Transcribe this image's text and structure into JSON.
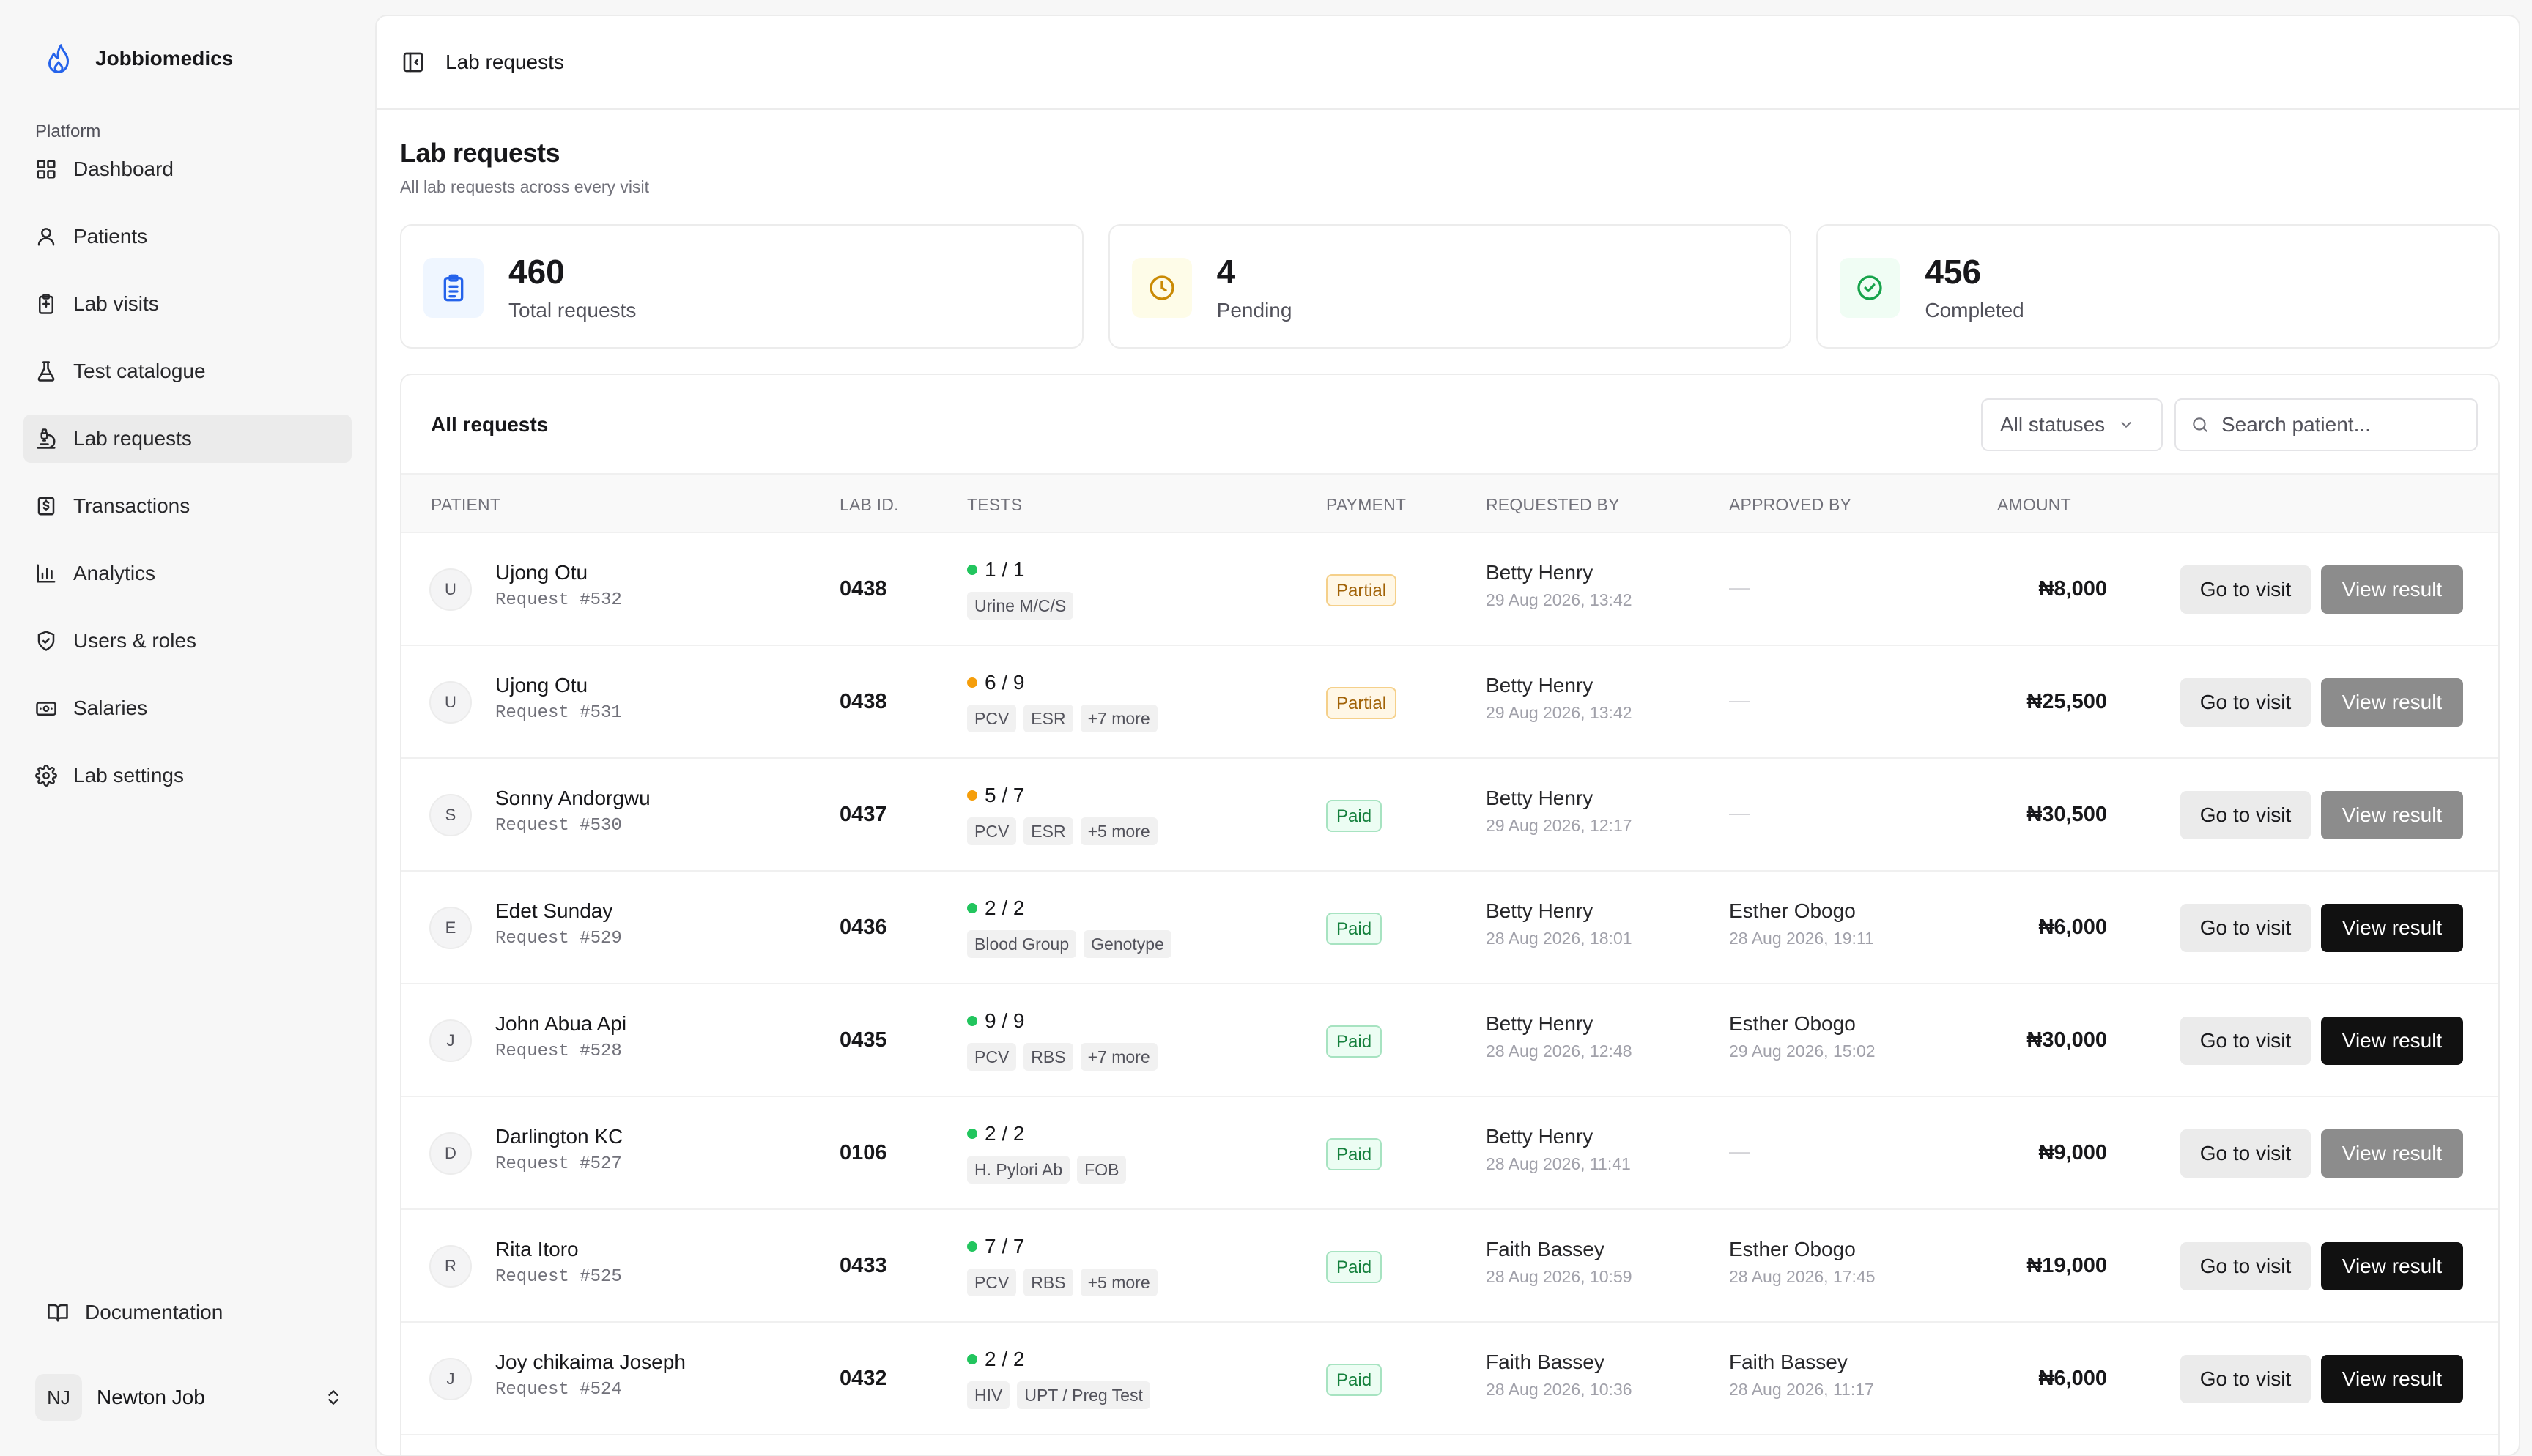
{
  "brand": {
    "name": "Jobbiomedics"
  },
  "sidebar": {
    "section": "Platform",
    "items": [
      {
        "label": "Dashboard",
        "icon": "dashboard-icon",
        "active": false
      },
      {
        "label": "Patients",
        "icon": "user-icon",
        "active": false
      },
      {
        "label": "Lab visits",
        "icon": "clipboard-icon",
        "active": false
      },
      {
        "label": "Test catalogue",
        "icon": "flask-icon",
        "active": false
      },
      {
        "label": "Lab requests",
        "icon": "microscope-icon",
        "active": true
      },
      {
        "label": "Transactions",
        "icon": "receipt-icon",
        "active": false
      },
      {
        "label": "Analytics",
        "icon": "bar-chart-icon",
        "active": false
      },
      {
        "label": "Users & roles",
        "icon": "shield-icon",
        "active": false
      },
      {
        "label": "Salaries",
        "icon": "wallet-icon",
        "active": false
      },
      {
        "label": "Lab settings",
        "icon": "gear-icon",
        "active": false
      }
    ],
    "documentation": "Documentation",
    "user": {
      "initials": "NJ",
      "name": "Newton Job"
    }
  },
  "topbar": {
    "breadcrumb": "Lab requests"
  },
  "page": {
    "title": "Lab requests",
    "subtitle": "All lab requests across every visit"
  },
  "stats": [
    {
      "value": "460",
      "label": "Total requests",
      "icon": "clipboard-list-icon",
      "color": "#2563eb",
      "bg": "#eff6ff"
    },
    {
      "value": "4",
      "label": "Pending",
      "icon": "clock-icon",
      "color": "#ca8a04",
      "bg": "#fefce8"
    },
    {
      "value": "456",
      "label": "Completed",
      "icon": "check-circle-icon",
      "color": "#16a34a",
      "bg": "#f0fdf4"
    }
  ],
  "table": {
    "title": "All requests",
    "status_filter": "All statuses",
    "search_placeholder": "Search patient...",
    "columns": [
      "Patient",
      "Lab ID.",
      "Tests",
      "Payment",
      "Requested by",
      "Approved by",
      "Amount"
    ],
    "go_label": "Go to visit",
    "view_label": "View result",
    "rows": [
      {
        "initial": "U",
        "name": "Ujong Otu",
        "request": "Request #532",
        "lab_id": "0438",
        "tests_done": "1 / 1",
        "status_dot": "#22c55e",
        "tags": [
          "Urine M/C/S"
        ],
        "payment": "Partial",
        "requested_by": "Betty Henry",
        "requested_at": "29 Aug 2026, 13:42",
        "approved_by": "",
        "approved_at": "",
        "amount": "₦8,000",
        "result_ready": false
      },
      {
        "initial": "U",
        "name": "Ujong Otu",
        "request": "Request #531",
        "lab_id": "0438",
        "tests_done": "6 / 9",
        "status_dot": "#f59e0b",
        "tags": [
          "PCV",
          "ESR",
          "+7 more"
        ],
        "payment": "Partial",
        "requested_by": "Betty Henry",
        "requested_at": "29 Aug 2026, 13:42",
        "approved_by": "",
        "approved_at": "",
        "amount": "₦25,500",
        "result_ready": false
      },
      {
        "initial": "S",
        "name": "Sonny Andorgwu",
        "request": "Request #530",
        "lab_id": "0437",
        "tests_done": "5 / 7",
        "status_dot": "#f59e0b",
        "tags": [
          "PCV",
          "ESR",
          "+5 more"
        ],
        "payment": "Paid",
        "requested_by": "Betty Henry",
        "requested_at": "29 Aug 2026, 12:17",
        "approved_by": "",
        "approved_at": "",
        "amount": "₦30,500",
        "result_ready": false
      },
      {
        "initial": "E",
        "name": "Edet Sunday",
        "request": "Request #529",
        "lab_id": "0436",
        "tests_done": "2 / 2",
        "status_dot": "#22c55e",
        "tags": [
          "Blood Group",
          "Genotype"
        ],
        "payment": "Paid",
        "requested_by": "Betty Henry",
        "requested_at": "28 Aug 2026, 18:01",
        "approved_by": "Esther Obogo",
        "approved_at": "28 Aug 2026, 19:11",
        "amount": "₦6,000",
        "result_ready": true
      },
      {
        "initial": "J",
        "name": "John Abua Api",
        "request": "Request #528",
        "lab_id": "0435",
        "tests_done": "9 / 9",
        "status_dot": "#22c55e",
        "tags": [
          "PCV",
          "RBS",
          "+7 more"
        ],
        "payment": "Paid",
        "requested_by": "Betty Henry",
        "requested_at": "28 Aug 2026, 12:48",
        "approved_by": "Esther Obogo",
        "approved_at": "29 Aug 2026, 15:02",
        "amount": "₦30,000",
        "result_ready": true
      },
      {
        "initial": "D",
        "name": "Darlington KC",
        "request": "Request #527",
        "lab_id": "0106",
        "tests_done": "2 / 2",
        "status_dot": "#22c55e",
        "tags": [
          "H. Pylori Ab",
          "FOB"
        ],
        "payment": "Paid",
        "requested_by": "Betty Henry",
        "requested_at": "28 Aug 2026, 11:41",
        "approved_by": "",
        "approved_at": "",
        "amount": "₦9,000",
        "result_ready": false
      },
      {
        "initial": "R",
        "name": "Rita Itoro",
        "request": "Request #525",
        "lab_id": "0433",
        "tests_done": "7 / 7",
        "status_dot": "#22c55e",
        "tags": [
          "PCV",
          "RBS",
          "+5 more"
        ],
        "payment": "Paid",
        "requested_by": "Faith Bassey",
        "requested_at": "28 Aug 2026, 10:59",
        "approved_by": "Esther Obogo",
        "approved_at": "28 Aug 2026, 17:45",
        "amount": "₦19,000",
        "result_ready": true
      },
      {
        "initial": "J",
        "name": "Joy chikaima Joseph",
        "request": "Request #524",
        "lab_id": "0432",
        "tests_done": "2 / 2",
        "status_dot": "#22c55e",
        "tags": [
          "HIV",
          "UPT / Preg Test"
        ],
        "payment": "Paid",
        "requested_by": "Faith Bassey",
        "requested_at": "28 Aug 2026, 10:36",
        "approved_by": "Faith Bassey",
        "approved_at": "28 Aug 2026, 11:17",
        "amount": "₦6,000",
        "result_ready": true
      }
    ]
  }
}
